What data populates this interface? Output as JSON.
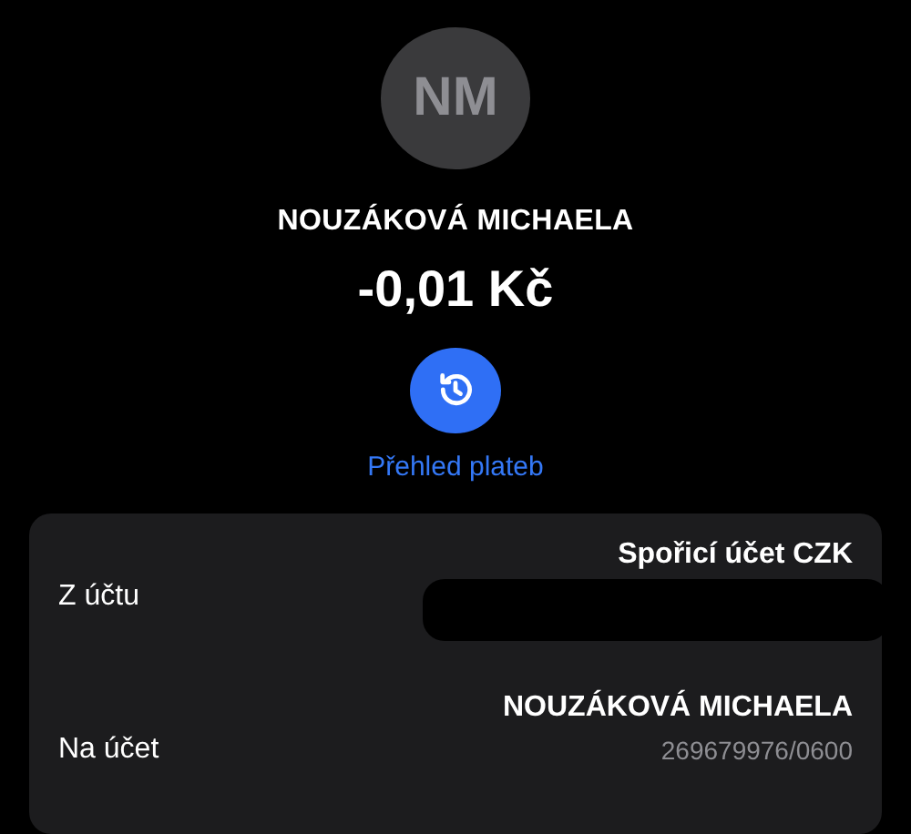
{
  "avatar": {
    "initials": "NM"
  },
  "counterparty": "NOUZÁKOVÁ MICHAELA",
  "amount": "-0,01 Kč",
  "history_button": {
    "label": "Přehled plateb"
  },
  "details": [
    {
      "label": "Z účtu",
      "value": "Spořicí účet CZK",
      "redacted": true
    },
    {
      "label": "Na účet",
      "value": "NOUZÁKOVÁ MICHAELA",
      "account": "269679976/0600",
      "redacted": false
    }
  ]
}
